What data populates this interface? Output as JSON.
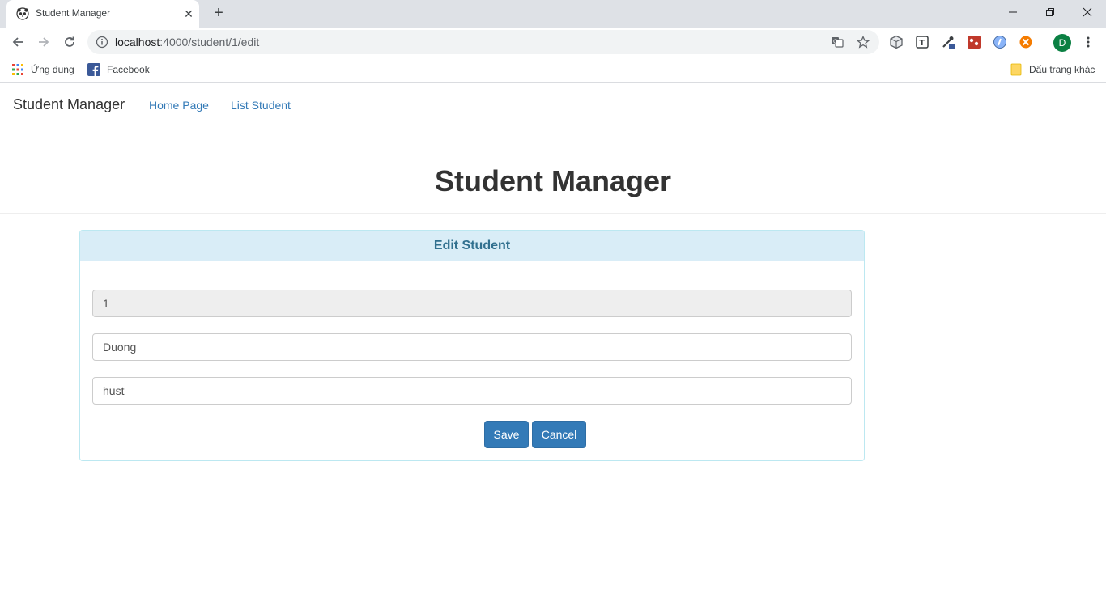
{
  "browser": {
    "tab_title": "Student Manager",
    "url_host": "localhost",
    "url_path": ":4000/student/1/edit",
    "profile_initial": "D",
    "bookmarks": [
      {
        "label": "Ứng dụng",
        "icon": "apps-grid-icon"
      },
      {
        "label": "Facebook",
        "icon": "facebook-icon"
      }
    ],
    "other_bookmarks": "Dấu trang khác"
  },
  "navbar": {
    "brand": "Student Manager",
    "links": [
      "Home Page",
      "List Student"
    ]
  },
  "header": {
    "title": "Student Manager"
  },
  "panel": {
    "heading": "Edit Student",
    "fields": {
      "id": "1",
      "name": "Duong",
      "school": "hust"
    },
    "save_label": "Save",
    "cancel_label": "Cancel"
  },
  "colors": {
    "link": "#337ab7",
    "primary_button": "#337ab7",
    "panel_heading_bg": "#d9edf7",
    "panel_heading_text": "#31708f",
    "profile_avatar": "#0b8043"
  }
}
